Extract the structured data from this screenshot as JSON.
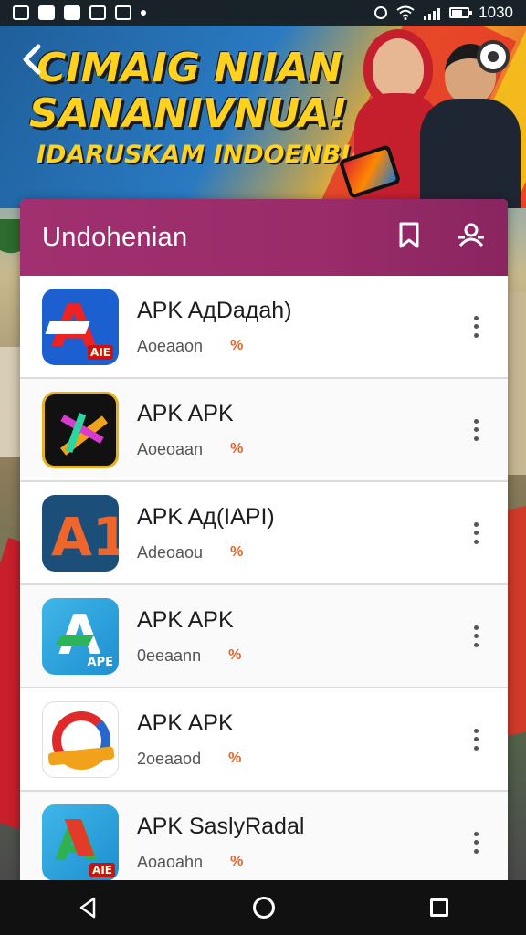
{
  "status_bar": {
    "time": "1030"
  },
  "banner": {
    "headline_line1": "CIMAIG NIIAN",
    "headline_line2": "SANANIVNUA!",
    "headline_line3": "IDARUSKAM INDOENBIAR"
  },
  "card": {
    "title": "Undohenian",
    "header_color": "#9a2c6a"
  },
  "apps": [
    {
      "name": "APK AдDaдah)",
      "subtitle": "Aoeaaon",
      "badge": "%"
    },
    {
      "name": "APK APK",
      "subtitle": "Aoeoaan",
      "badge": "%"
    },
    {
      "name": "APK Aд(IAPI)",
      "subtitle": "Adeoaou",
      "badge": "%"
    },
    {
      "name": "APK APK",
      "subtitle": "0eeaann",
      "badge": "%"
    },
    {
      "name": "APK APK",
      "subtitle": "2oeaaod",
      "badge": "%"
    },
    {
      "name": "APK SaslyRadal",
      "subtitle": "Aoaoahn",
      "badge": "%"
    }
  ],
  "icons": {
    "app1": "A",
    "app1_tag": "AIE",
    "app3": "A1",
    "app4": "A",
    "app4_tag": "APE",
    "app6": "A",
    "app6_tag": "AIE"
  },
  "navbar": {
    "icons": [
      "back-icon",
      "home-icon",
      "recents-icon"
    ]
  }
}
